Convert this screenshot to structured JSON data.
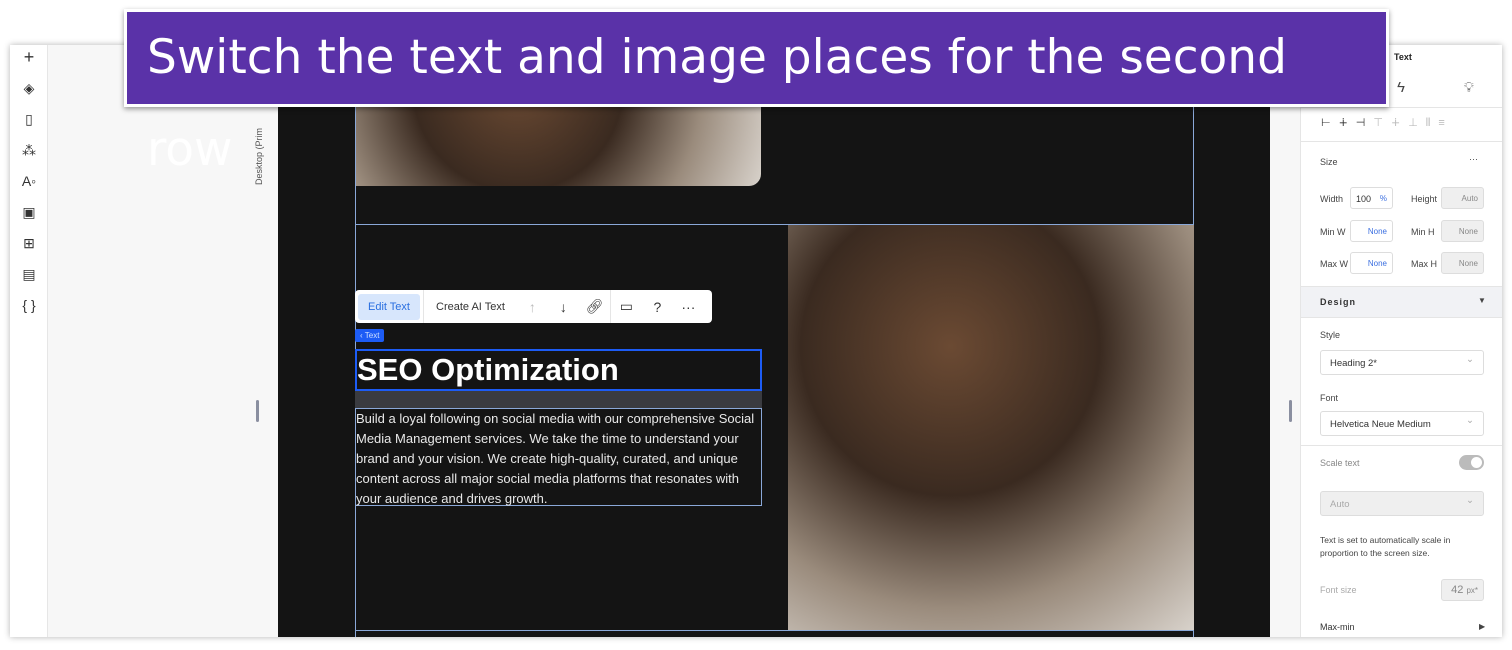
{
  "banner": "Switch the text and image places for the second row",
  "left_toolbar": [
    "plus-icon",
    "layers-icon",
    "page-icon",
    "connections-icon",
    "typography-icon",
    "image-icon",
    "apps-icon",
    "table-icon",
    "code-icon"
  ],
  "breakpoint_label": "Desktop (Prim",
  "toolbar": {
    "edit_text": "Edit Text",
    "create_ai_text": "Create AI Text"
  },
  "tag": "‹ Text",
  "heading": "SEO Optimization",
  "paragraph": "Build a loyal following on social media with our comprehensive Social Media Management services. We take the time to understand your brand and your vision. We create high-quality, curated, and unique content across all major social media platforms that resonates with your audience and drives growth.",
  "panel": {
    "title": "Text",
    "size": "Size",
    "width_label": "Width",
    "width": "100",
    "width_unit": "%",
    "height_label": "Height",
    "height": "Auto",
    "minw_label": "Min W",
    "minw": "None",
    "minh_label": "Min H",
    "minh": "None",
    "maxw_label": "Max W",
    "maxw": "None",
    "maxh_label": "Max H",
    "maxh": "None",
    "design": "Design",
    "style_label": "Style",
    "style": "Heading 2*",
    "font_label": "Font",
    "font": "Helvetica Neue Medium",
    "scale_text": "Scale text",
    "scale_mode": "Auto",
    "scale_note": "Text is set to automatically scale in proportion to the screen size.",
    "font_size_label": "Font size",
    "font_size": "42",
    "font_size_unit": "px*",
    "maxmin": "Max-min"
  }
}
